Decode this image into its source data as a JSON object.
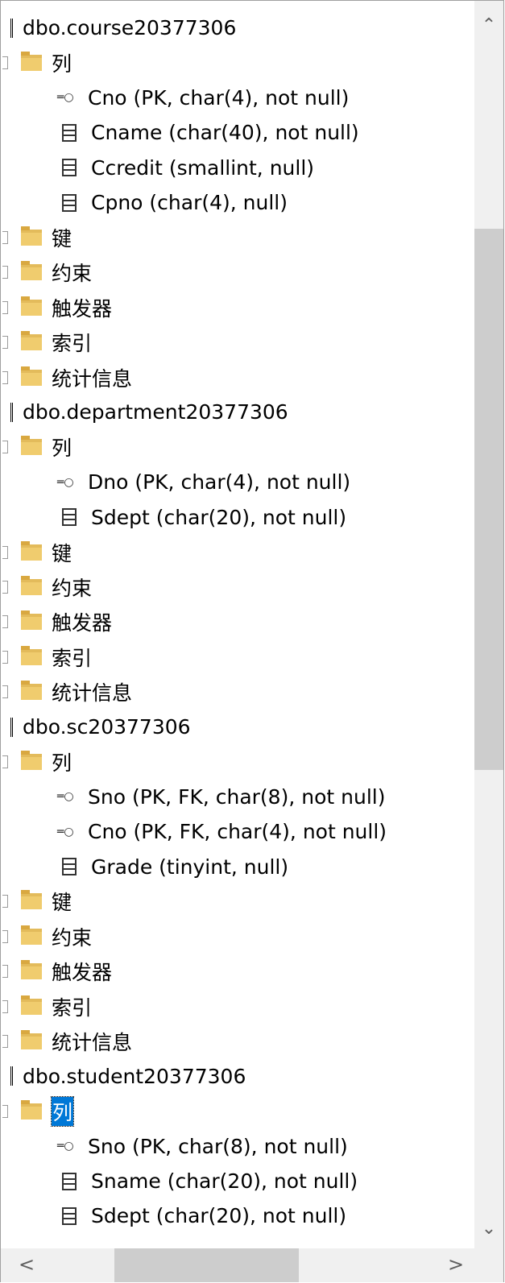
{
  "tree": {
    "tables": [
      {
        "name": "dbo.course20377306",
        "folders_before": [
          "列"
        ],
        "columns": [
          {
            "label": "Cno (PK, char(4), not null)",
            "icon": "key-icon"
          },
          {
            "label": "Cname (char(40), not null)",
            "icon": "column-icon"
          },
          {
            "label": "Ccredit (smallint, null)",
            "icon": "column-icon"
          },
          {
            "label": "Cpno (char(4), null)",
            "icon": "column-icon"
          }
        ],
        "folders_after": [
          "键",
          "约束",
          "触发器",
          "索引",
          "统计信息"
        ]
      },
      {
        "name": "dbo.department20377306",
        "folders_before": [
          "列"
        ],
        "columns": [
          {
            "label": "Dno (PK, char(4), not null)",
            "icon": "key-icon"
          },
          {
            "label": "Sdept (char(20), not null)",
            "icon": "column-icon"
          }
        ],
        "folders_after": [
          "键",
          "约束",
          "触发器",
          "索引",
          "统计信息"
        ]
      },
      {
        "name": "dbo.sc20377306",
        "folders_before": [
          "列"
        ],
        "columns": [
          {
            "label": "Sno (PK, FK, char(8), not null)",
            "icon": "key-icon"
          },
          {
            "label": "Cno (PK, FK, char(4), not null)",
            "icon": "key-icon"
          },
          {
            "label": "Grade (tinyint, null)",
            "icon": "column-icon"
          }
        ],
        "folders_after": [
          "键",
          "约束",
          "触发器",
          "索引",
          "统计信息"
        ]
      },
      {
        "name": "dbo.student20377306",
        "folders_before": [
          "列"
        ],
        "selected_folder": "列",
        "columns": [
          {
            "label": "Sno (PK, char(8), not null)",
            "icon": "key-icon"
          },
          {
            "label": "Sname (char(20), not null)",
            "icon": "column-icon"
          },
          {
            "label": "Sdept (char(20), not null)",
            "icon": "column-icon"
          }
        ],
        "folders_after": []
      }
    ]
  },
  "scrollbars": {
    "up_icon": "chevron-up-icon",
    "down_icon": "chevron-down-icon",
    "left_icon": "chevron-left-icon",
    "right_icon": "chevron-right-icon"
  },
  "colors": {
    "selection": "#0078d7",
    "folder": "#f0cc6e"
  }
}
